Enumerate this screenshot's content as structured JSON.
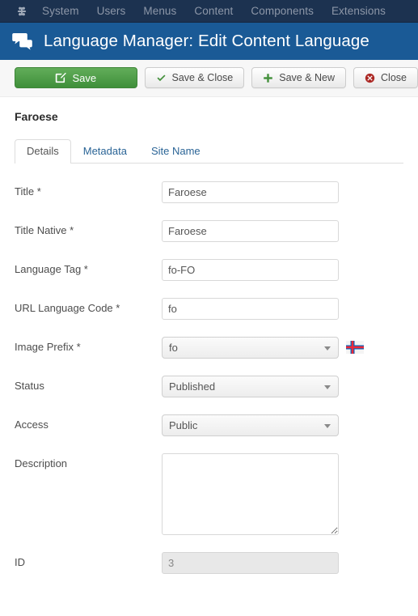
{
  "topnav": {
    "logo_icon": "joomla-logo-icon",
    "items": [
      {
        "label": "System"
      },
      {
        "label": "Users"
      },
      {
        "label": "Menus"
      },
      {
        "label": "Content"
      },
      {
        "label": "Components"
      },
      {
        "label": "Extensions"
      }
    ]
  },
  "header": {
    "icon": "comments-icon",
    "title": "Language Manager: Edit Content Language",
    "background_color": "#1a5a96"
  },
  "toolbar": {
    "buttons": [
      {
        "label": "Save",
        "icon": "pencil-square-icon",
        "style": "primary-green"
      },
      {
        "label": "Save & Close",
        "icon": "check-icon",
        "style": "default"
      },
      {
        "label": "Save & New",
        "icon": "plus-icon",
        "style": "default"
      },
      {
        "label": "Close",
        "icon": "cancel-circle-icon",
        "style": "default"
      }
    ]
  },
  "record": {
    "title": "Faroese"
  },
  "tabs": [
    {
      "label": "Details",
      "active": true
    },
    {
      "label": "Metadata",
      "active": false
    },
    {
      "label": "Site Name",
      "active": false
    }
  ],
  "form": {
    "title": {
      "label": "Title *",
      "value": "Faroese"
    },
    "title_native": {
      "label": "Title Native *",
      "value": "Faroese"
    },
    "language_tag": {
      "label": "Language Tag *",
      "value": "fo-FO"
    },
    "url_language_code": {
      "label": "URL Language Code *",
      "value": "fo"
    },
    "image_prefix": {
      "label": "Image Prefix *",
      "value": "fo",
      "flag_icon": "faroe-islands-flag-icon"
    },
    "status": {
      "label": "Status",
      "value": "Published"
    },
    "access": {
      "label": "Access",
      "value": "Public"
    },
    "description": {
      "label": "Description",
      "value": ""
    },
    "id": {
      "label": "ID",
      "value": "3"
    }
  },
  "colors": {
    "topnav_bg": "#1c3250",
    "header_bg": "#1a5a96",
    "save_green": "#44943d",
    "link_blue": "#2a6496",
    "close_red": "#b02b2b"
  }
}
